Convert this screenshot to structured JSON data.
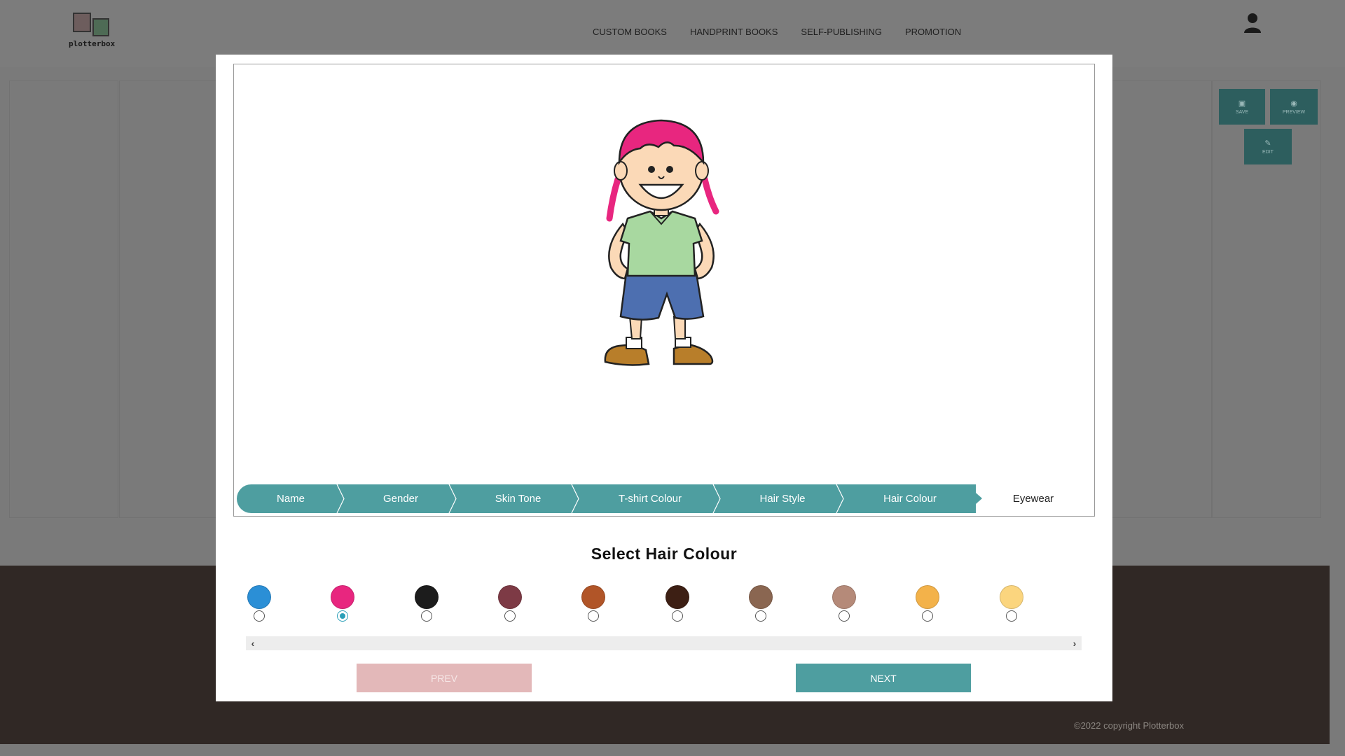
{
  "header": {
    "logo_text": "plotterbox",
    "nav": [
      "CUSTOM BOOKS",
      "HANDPRINT BOOKS",
      "SELF-PUBLISHING",
      "PROMOTION"
    ]
  },
  "toolbar": {
    "save_label": "SAVE",
    "preview_label": "PREVIEW",
    "edit_label": "EDIT"
  },
  "wizard": {
    "steps": [
      {
        "label": "Name",
        "state": "done"
      },
      {
        "label": "Gender",
        "state": "done"
      },
      {
        "label": "Skin Tone",
        "state": "done"
      },
      {
        "label": "T-shirt Colour",
        "state": "done"
      },
      {
        "label": "Hair Style",
        "state": "done"
      },
      {
        "label": "Hair Colour",
        "state": "done"
      },
      {
        "label": "Eyewear",
        "state": "current"
      }
    ],
    "section_title": "Select Hair Colour",
    "selected_index": 1,
    "colours": [
      "#2b8fd6",
      "#e8267f",
      "#1c1c1c",
      "#7d3a45",
      "#b15528",
      "#3d1f14",
      "#8a6651",
      "#b58a79",
      "#f3b24a",
      "#fbd57e"
    ],
    "prev_label": "PREV",
    "next_label": "NEXT"
  },
  "footer": {
    "copyright": "©2022 copyright Plotterbox"
  },
  "colors": {
    "accent": "#4e9ea0",
    "prev_disabled": "#e3b8b9",
    "footer_bg": "#302825"
  }
}
